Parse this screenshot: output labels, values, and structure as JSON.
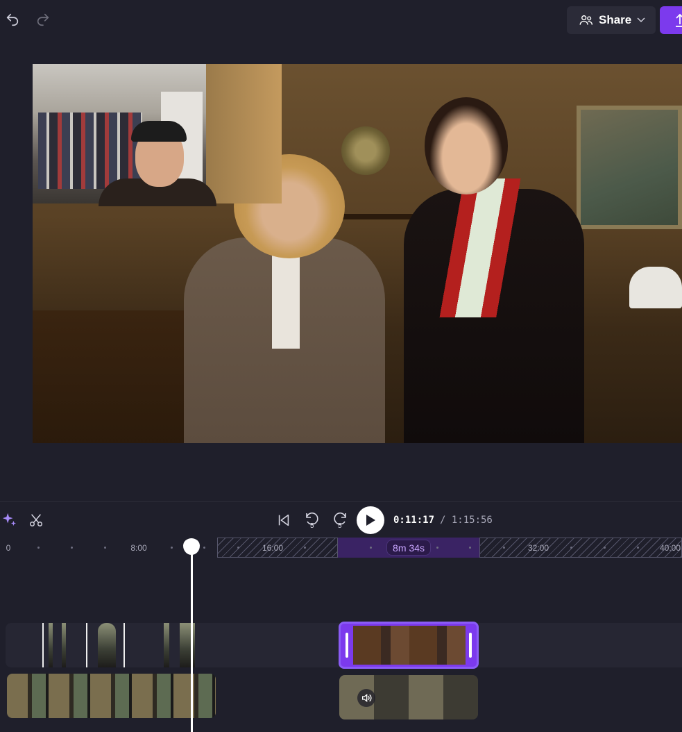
{
  "header": {
    "share_label": "Share",
    "icons": [
      "undo-icon",
      "redo-icon",
      "share-people-icon",
      "chevron-down-icon",
      "export-icon"
    ],
    "accent_color": "#7c3aed"
  },
  "preview": {
    "description_icon": "video-frame"
  },
  "controls": {
    "time_current": "0:11:17",
    "time_total": "/ 1:15:56",
    "icons": [
      "sparkle-icon",
      "scissors-icon",
      "skip-to-start-icon",
      "rewind-5-icon",
      "forward-5-icon",
      "play-icon"
    ],
    "rewind_seconds": "5",
    "forward_seconds": "5"
  },
  "ruler": {
    "labels": [
      "0",
      "8:00",
      "16:00",
      "32:00",
      "40:00"
    ],
    "gap_label": "8m 34s"
  }
}
